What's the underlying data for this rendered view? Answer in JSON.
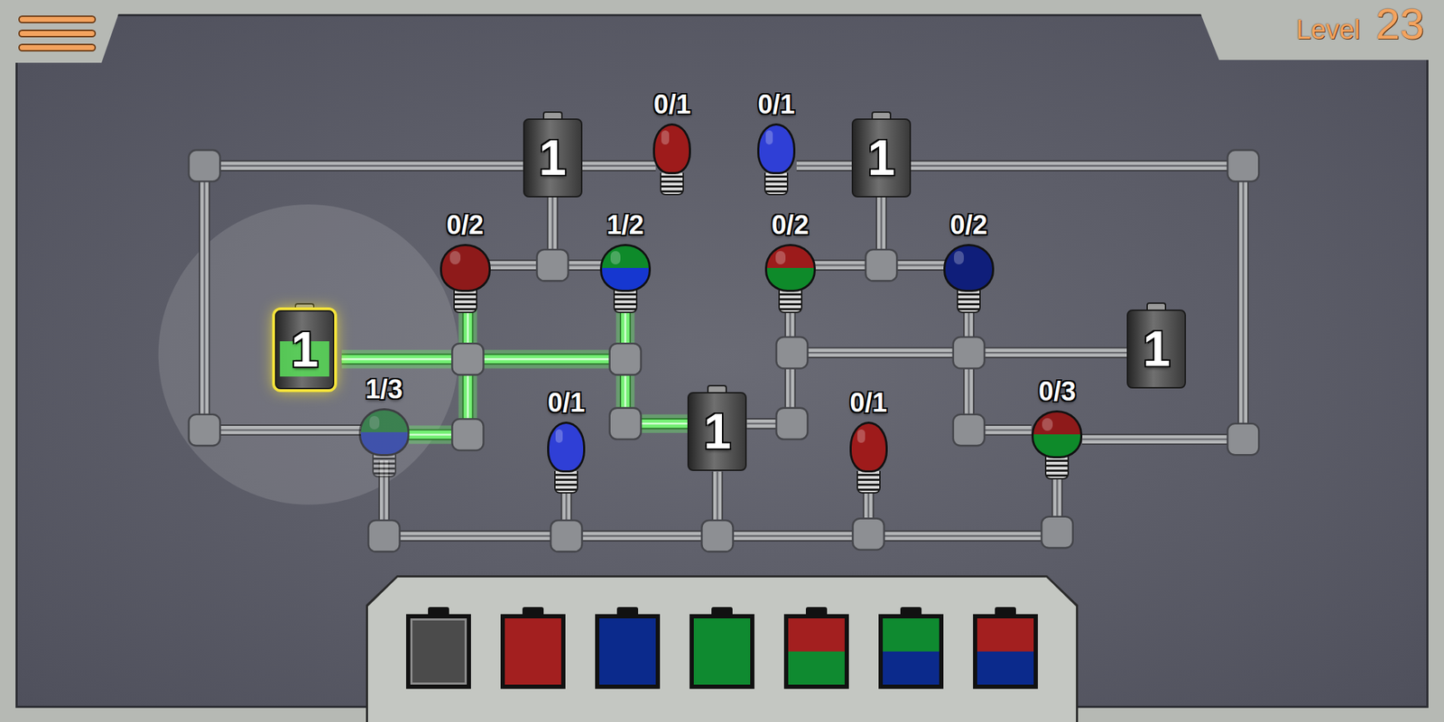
{
  "level": {
    "label": "Level",
    "number": "23"
  },
  "batteries": [
    {
      "value": "1",
      "selected": false,
      "colors": []
    },
    {
      "value": "1",
      "selected": false,
      "colors": []
    },
    {
      "value": "1",
      "selected": false,
      "colors": []
    },
    {
      "value": "1",
      "selected": false,
      "colors": []
    },
    {
      "value": "1",
      "selected": true,
      "colors": [
        "#5ad65a"
      ]
    }
  ],
  "bulbs": [
    {
      "count": "0/1",
      "colors": [
        "#9e1b1b"
      ],
      "kind": "small",
      "faded": false
    },
    {
      "count": "0/1",
      "colors": [
        "#2f3fd6"
      ],
      "kind": "small",
      "faded": false
    },
    {
      "count": "0/2",
      "colors": [
        "#8e1a1a"
      ],
      "kind": "round",
      "faded": false
    },
    {
      "count": "1/2",
      "colors": [
        "#0e8a2a",
        "#1637d0"
      ],
      "kind": "round",
      "faded": false
    },
    {
      "count": "0/2",
      "colors": [
        "#9c1b1b",
        "#0e8a2a"
      ],
      "kind": "round",
      "faded": false
    },
    {
      "count": "0/2",
      "colors": [
        "#0f1e7a"
      ],
      "kind": "round",
      "faded": false
    },
    {
      "count": "1/3",
      "colors": [
        "#0e8a2a",
        "#1637d0"
      ],
      "kind": "round",
      "faded": true
    },
    {
      "count": "0/1",
      "colors": [
        "#2f3fd6"
      ],
      "kind": "small",
      "faded": false
    },
    {
      "count": "0/1",
      "colors": [
        "#9e1b1b"
      ],
      "kind": "small",
      "faded": false
    },
    {
      "count": "0/3",
      "colors": [
        "#8e1a1a",
        "#0e8a2a"
      ],
      "kind": "round",
      "faded": false
    }
  ],
  "wires": [
    {
      "powered": false
    },
    {
      "powered": false
    },
    {
      "powered": false
    },
    {
      "powered": false
    },
    {
      "powered": false
    },
    {
      "powered": false
    },
    {
      "powered": false
    },
    {
      "powered": true
    },
    {
      "powered": false
    },
    {
      "powered": false
    },
    {
      "powered": false
    },
    {
      "powered": false
    },
    {
      "powered": true
    },
    {
      "powered": true
    },
    {
      "powered": true
    },
    {
      "powered": true
    },
    {
      "powered": false
    },
    {
      "powered": false
    },
    {
      "powered": false
    },
    {
      "powered": false
    },
    {
      "powered": false
    },
    {
      "powered": false
    },
    {
      "powered": false
    },
    {
      "powered": false
    },
    {
      "powered": false
    },
    {
      "powered": false
    },
    {
      "powered": false
    },
    {
      "powered": false
    }
  ],
  "palette": [
    {
      "colors": [],
      "selected": false
    },
    {
      "colors": [
        "#a31f1f"
      ],
      "selected": false
    },
    {
      "colors": [
        "#0b2a8c"
      ],
      "selected": false
    },
    {
      "colors": [
        "#0f8a30"
      ],
      "selected": false
    },
    {
      "colors": [
        "#a31f1f",
        "#0f8a30"
      ],
      "selected": false
    },
    {
      "colors": [
        "#0f8a30",
        "#0b2a8c"
      ],
      "selected": false
    },
    {
      "colors": [
        "#a31f1f",
        "#0b2a8c"
      ],
      "selected": false
    }
  ]
}
